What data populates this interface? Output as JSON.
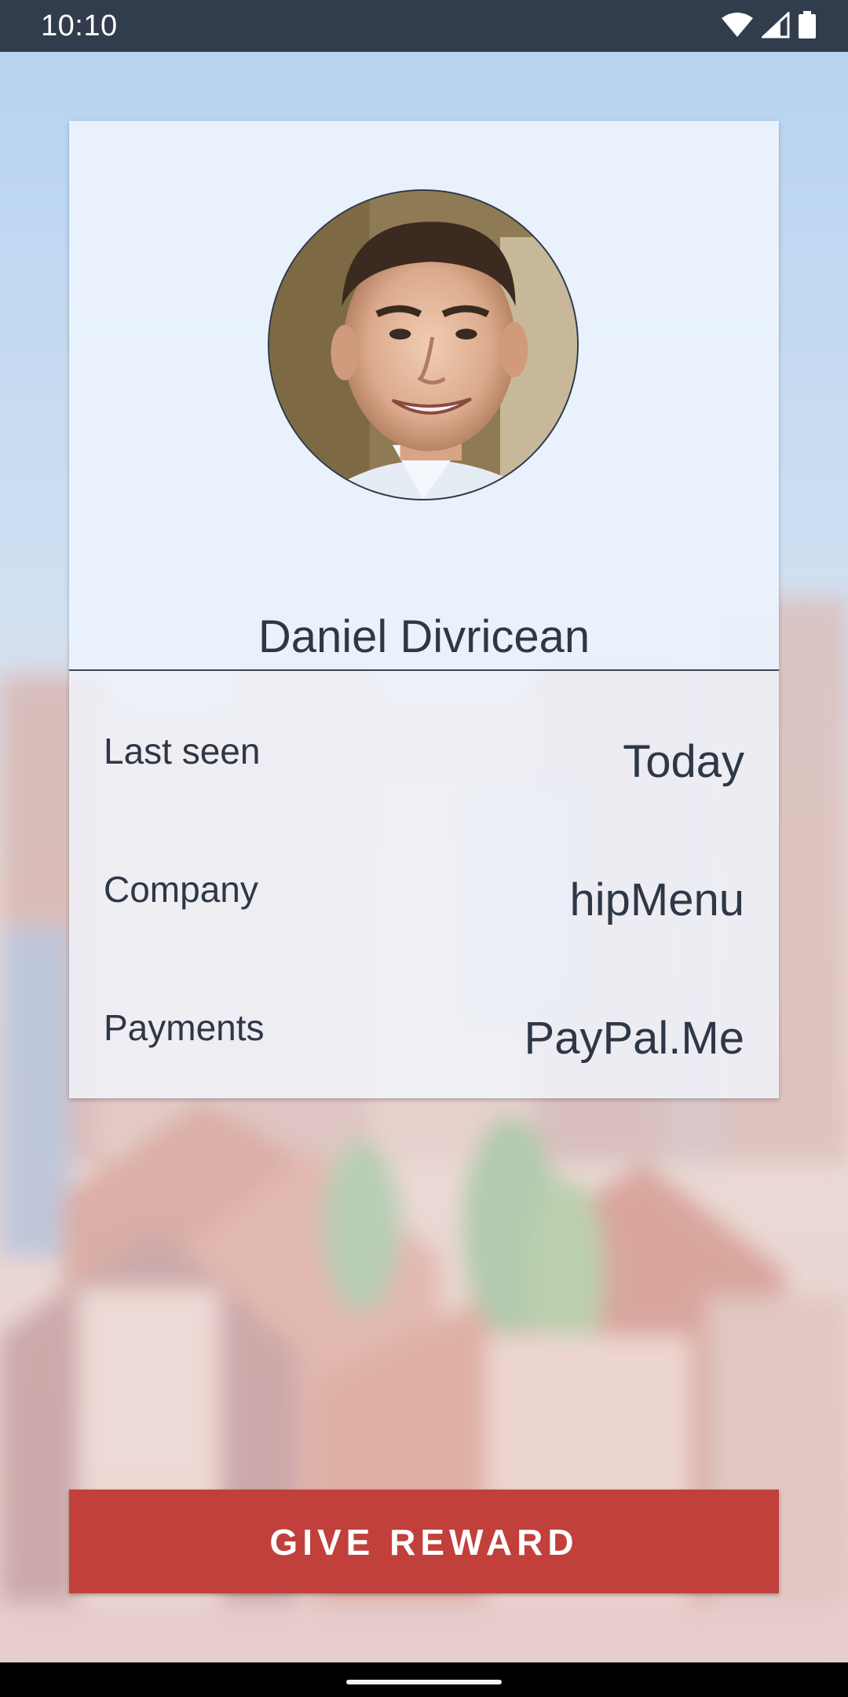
{
  "status_bar": {
    "time": "10:10",
    "icons": [
      "wifi-icon",
      "cellular-signal-icon",
      "battery-icon"
    ]
  },
  "profile": {
    "name": "Daniel Divricean",
    "avatar": "profile-photo"
  },
  "details": [
    {
      "label": "Last seen",
      "value": "Today"
    },
    {
      "label": "Company",
      "value": "hipMenu"
    },
    {
      "label": "Payments",
      "value": "PayPal.Me"
    }
  ],
  "action_button": {
    "label": "GIVE REWARD"
  },
  "colors": {
    "status_bar": "#313c4c",
    "accent_button": "#c1403c",
    "text_primary": "#2e3746"
  }
}
